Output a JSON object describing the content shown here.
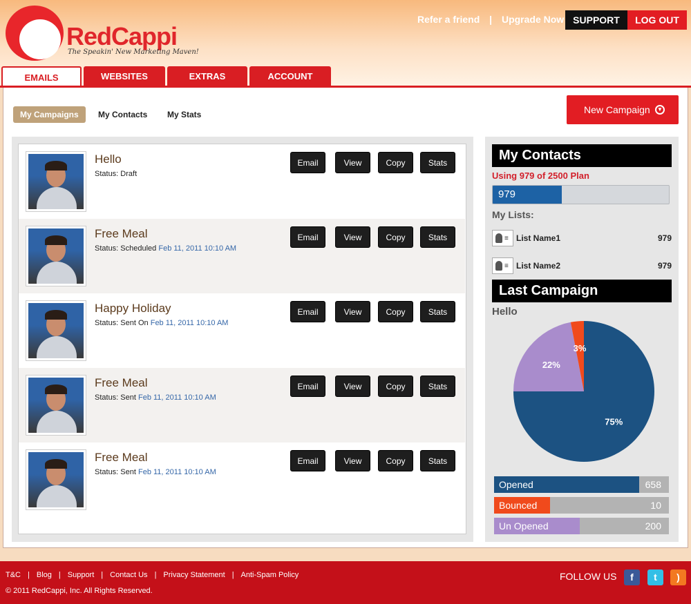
{
  "brand": {
    "name": "RedCappi",
    "tagline": "The Speakin' New Marketing Maven!"
  },
  "header": {
    "links": [
      "Refer a friend",
      "|",
      "Upgrade Now"
    ],
    "support": "SUPPORT",
    "logout": "LOG OUT"
  },
  "tabs": [
    "EMAILS",
    "WEBSITES",
    "EXTRAS",
    "ACCOUNT"
  ],
  "subtabs": [
    "My Campaigns",
    "My Contacts",
    "My Stats"
  ],
  "new_campaign": "New Campaign",
  "actions": [
    "Email",
    "View",
    "Copy",
    "Stats"
  ],
  "campaigns": [
    {
      "title": "Hello",
      "status": "Status: Draft",
      "date": ""
    },
    {
      "title": "Free Meal",
      "status": "Status: Scheduled",
      "date": "Feb 11, 2011 10:10 AM"
    },
    {
      "title": "Happy Holiday",
      "status": "Status: Sent On",
      "date": "Feb 11, 2011 10:10 AM"
    },
    {
      "title": "Free Meal",
      "status": "Status: Sent",
      "date": "Feb 11, 2011 10:10 AM"
    },
    {
      "title": "Free Meal",
      "status": "Status: Sent",
      "date": "Feb 11, 2011 10:10 AM"
    }
  ],
  "contacts": {
    "heading": "My Contacts",
    "usage": "Using 979 of 2500 Plan",
    "count": "979",
    "used": 979,
    "plan": 2500,
    "lists_label": "My Lists:",
    "lists": [
      {
        "name": "List Name1",
        "count": "979"
      },
      {
        "name": "List Name2",
        "count": "979"
      }
    ]
  },
  "last_campaign": {
    "heading": "Last Campaign",
    "name": "Hello",
    "slices": [
      {
        "label": "75%",
        "value": 75,
        "color": "#1c5282"
      },
      {
        "label": "22%",
        "value": 22,
        "color": "#a98ccc"
      },
      {
        "label": "3%",
        "value": 3,
        "color": "#f04a1c"
      }
    ],
    "stats": [
      {
        "label": "Opened",
        "value": "658",
        "fill": 0.83,
        "color": "#1c5282"
      },
      {
        "label": "Bounced",
        "value": "10",
        "fill": 0.32,
        "color": "#f04a1c"
      },
      {
        "label": "Un Opened",
        "value": "200",
        "fill": 0.49,
        "color": "#a98ccc"
      }
    ]
  },
  "footer": {
    "links": [
      "T&C",
      "Blog",
      "Support",
      "Contact Us",
      "Privacy Statement",
      "Anti-Spam Policy"
    ],
    "copyright": "© 2011 RedCappi, Inc. All Rights Reserved.",
    "follow": "FOLLOW US",
    "social": [
      {
        "name": "facebook-icon",
        "glyph": "f",
        "color": "#3b5998"
      },
      {
        "name": "twitter-icon",
        "glyph": "t",
        "color": "#33bfe6"
      },
      {
        "name": "rss-icon",
        "glyph": ")",
        "color": "#f37921"
      }
    ]
  }
}
